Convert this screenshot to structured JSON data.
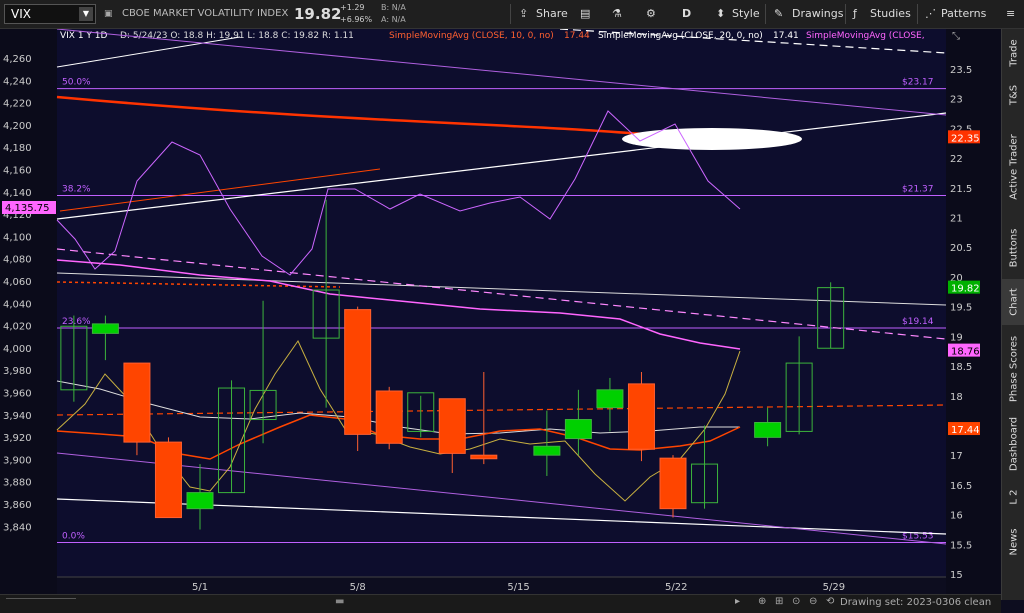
{
  "toolbar": {
    "symbol": "VIX",
    "title": "CBOE MARKET VOLATILITY INDEX",
    "last": "19.82",
    "change": "+1.29",
    "change_pct": "+6.96%",
    "bid": "B: N/A",
    "ask": "A: N/A",
    "share": "Share",
    "aggregation": "D",
    "style": "Style",
    "drawings": "Drawings",
    "studies": "Studies",
    "patterns": "Patterns"
  },
  "right_tabs": [
    "Trade",
    "T&S",
    "Active Trader",
    "Buttons",
    "Chart",
    "Phase Scores",
    "Dashboard",
    "L 2",
    "News"
  ],
  "bottom": {
    "drawing_set": "Drawing set: 2023-0306 clean"
  },
  "header_line": {
    "symbol_period": "VIX 1 Y 1D",
    "ohlc": "D: 5/24/23  O: 18.8  H: 19.91  L: 18.8  C: 19.82  R: 1.11",
    "sma10": "SimpleMovingAvg (CLOSE, 10, 0, no)",
    "sma10_val": "17.44",
    "sma20": "SimpleMovingAvg (CLOSE, 20, 0, no)",
    "sma20_val": "17.41",
    "sma3": "SimpleMovingAvg (CLOSE,"
  },
  "chart_data": {
    "type": "candlestick",
    "x_ticks": [
      "5/1",
      "5/8",
      "5/15",
      "5/22",
      "5/29"
    ],
    "right_axis": {
      "ticks": [
        "23.5",
        "23",
        "22.5",
        "22",
        "21.5",
        "21",
        "20.5",
        "20",
        "19.5",
        "19",
        "18.5",
        "18",
        "17.5",
        "17",
        "16.5",
        "16",
        "15.5",
        "15"
      ],
      "tag_last": "19.82",
      "tag_red": "22.35",
      "tag_ma_pink": "18.76",
      "tag_ma_orange": "17.44"
    },
    "left_axis": {
      "ticks": [
        "4,260",
        "4,240",
        "4,220",
        "4,200",
        "4,180",
        "4,160",
        "4,140",
        "4,120",
        "4,100",
        "4,080",
        "4,060",
        "4,040",
        "4,020",
        "4,000",
        "3,980",
        "3,960",
        "3,940",
        "3,920",
        "3,900",
        "3,880",
        "3,860",
        "3,840"
      ],
      "tag": "4,135.75"
    },
    "fib_levels": [
      {
        "pct": "50.0%",
        "value": "$23.17",
        "y": 23.17
      },
      {
        "pct": "38.2%",
        "value": "$21.37",
        "y": 21.37
      },
      {
        "pct": "23.6%",
        "value": "$19.14",
        "y": 19.14
      },
      {
        "pct": "0.0%",
        "value": "$15.53",
        "y": 15.53
      }
    ],
    "candles": [
      {
        "x": 0,
        "o": 18.1,
        "h": 19.35,
        "l": 17.9,
        "c": 19.17
      },
      {
        "x": 1,
        "o": 19.05,
        "h": 19.35,
        "l": 18.6,
        "c": 19.21
      },
      {
        "x": 2,
        "o": 18.55,
        "h": 18.55,
        "l": 17.0,
        "c": 17.22
      },
      {
        "x": 3,
        "o": 17.22,
        "h": 17.3,
        "l": 15.95,
        "c": 15.95
      },
      {
        "x": 4,
        "o": 16.1,
        "h": 16.85,
        "l": 15.75,
        "c": 16.37
      },
      {
        "x": 5,
        "o": 16.37,
        "h": 18.26,
        "l": 16.37,
        "c": 18.13
      },
      {
        "x": 6,
        "o": 17.6,
        "h": 19.6,
        "l": 17.2,
        "c": 18.09
      },
      {
        "x": 8,
        "o": 18.97,
        "h": 21.3,
        "l": 17.8,
        "c": 19.78
      },
      {
        "x": 9,
        "o": 19.45,
        "h": 19.5,
        "l": 17.07,
        "c": 17.35
      },
      {
        "x": 10,
        "o": 18.08,
        "h": 18.15,
        "l": 17.1,
        "c": 17.2
      },
      {
        "x": 11,
        "o": 17.4,
        "h": 18.0,
        "l": 17.3,
        "c": 18.05
      },
      {
        "x": 12,
        "o": 17.95,
        "h": 17.95,
        "l": 16.7,
        "c": 17.03
      },
      {
        "x": 13,
        "o": 17.0,
        "h": 18.4,
        "l": 16.85,
        "c": 16.94
      },
      {
        "x": 15,
        "o": 17.0,
        "h": 17.75,
        "l": 16.65,
        "c": 17.15
      },
      {
        "x": 16,
        "o": 17.28,
        "h": 18.1,
        "l": 17.0,
        "c": 17.6
      },
      {
        "x": 17,
        "o": 17.8,
        "h": 18.3,
        "l": 17.4,
        "c": 18.1
      },
      {
        "x": 18,
        "o": 18.2,
        "h": 18.4,
        "l": 16.9,
        "c": 17.1
      },
      {
        "x": 19,
        "o": 16.95,
        "h": 17.0,
        "l": 15.95,
        "c": 16.1
      },
      {
        "x": 20,
        "o": 16.2,
        "h": 17.5,
        "l": 16.1,
        "c": 16.85
      },
      {
        "x": 22,
        "o": 17.3,
        "h": 17.8,
        "l": 17.15,
        "c": 17.55
      },
      {
        "x": 23,
        "o": 17.4,
        "h": 19.0,
        "l": 17.35,
        "c": 18.55
      },
      {
        "x": 24,
        "o": 18.8,
        "h": 19.91,
        "l": 18.8,
        "c": 19.82
      }
    ],
    "colors": {
      "background": "#0d0d2d",
      "up_fill": "#00c000",
      "down_fill": "#ff4500",
      "fib": "#c060ff",
      "sma10": "#ff4500",
      "sma20": "#ffffff",
      "pink_ma": "#ff66ff",
      "orange_price": "#ff6a1a",
      "trendline": "#ffffff"
    }
  }
}
